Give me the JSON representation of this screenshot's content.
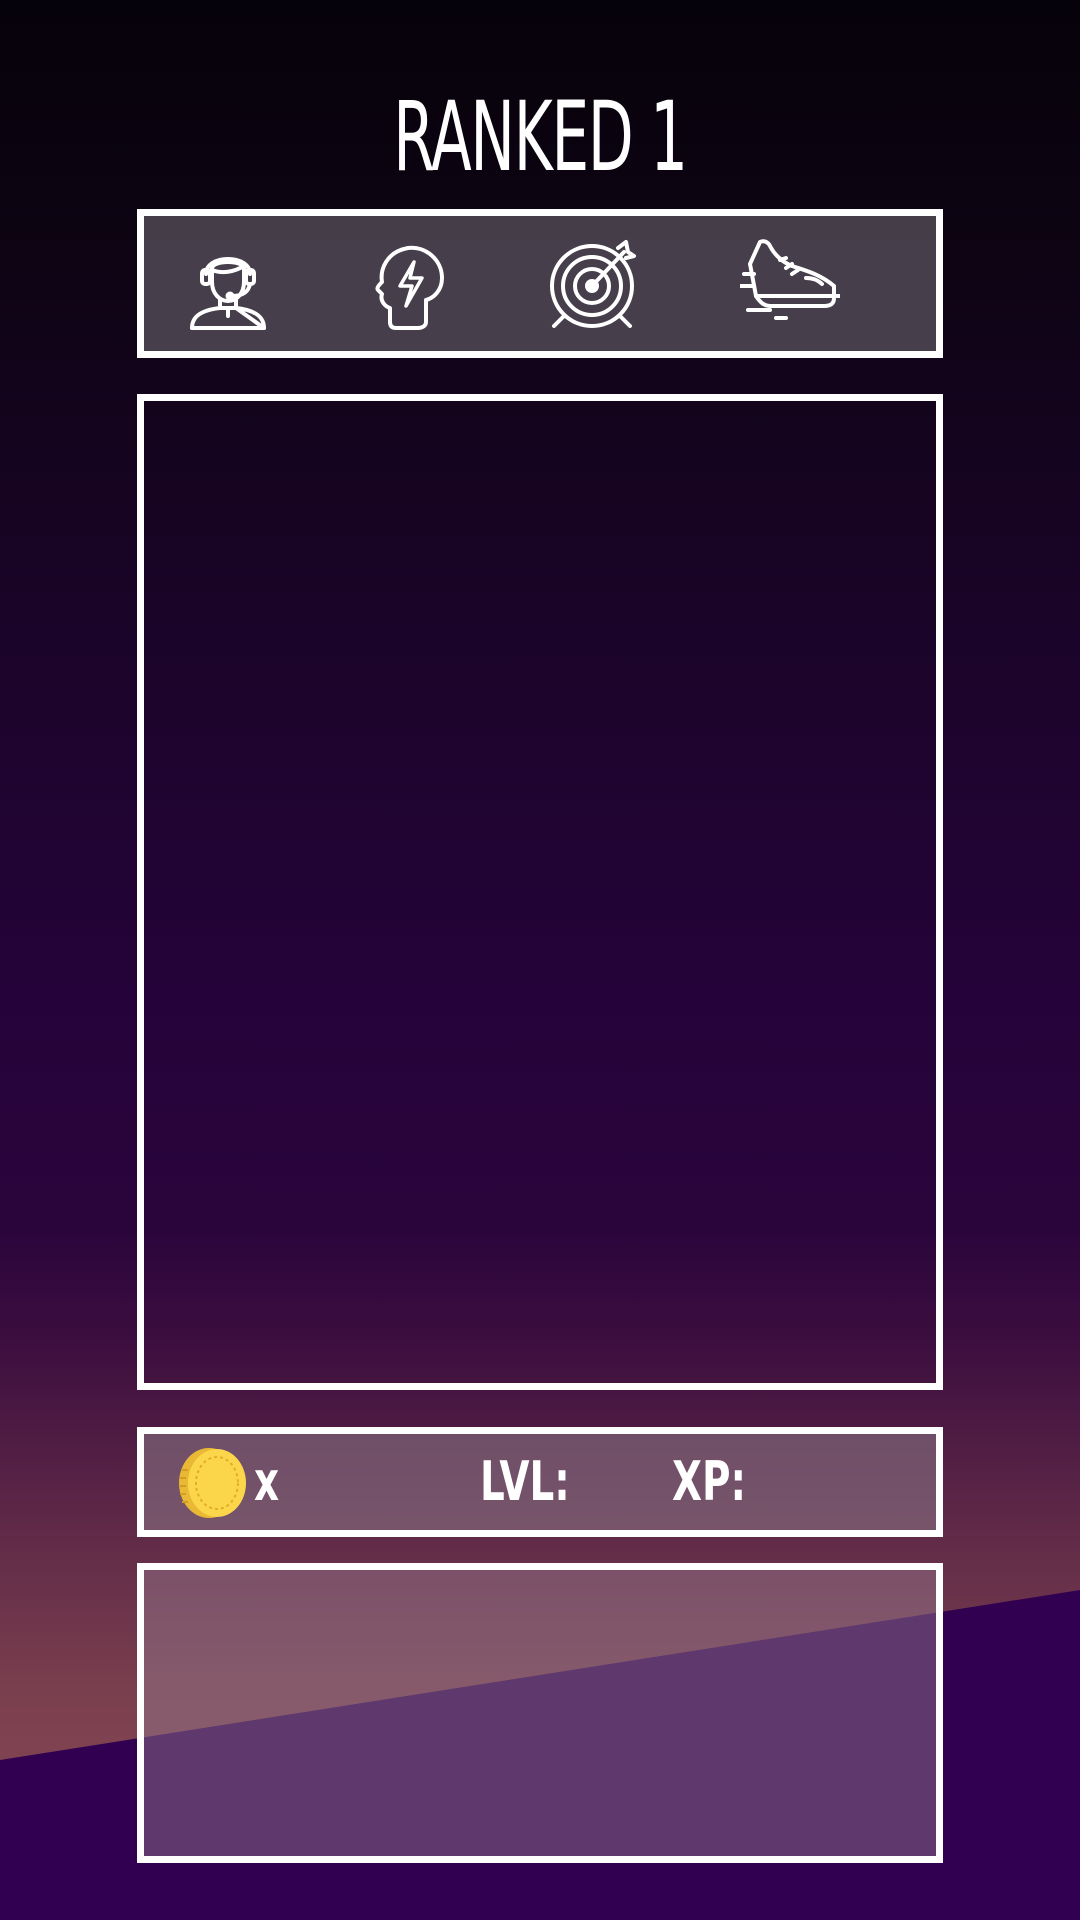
{
  "title": "RANKED 1",
  "stats": {
    "icons": [
      "support-agent-icon",
      "brain-lightning-icon",
      "target-dart-icon",
      "running-shoe-icon"
    ]
  },
  "info": {
    "coins_label": "x",
    "level_label": "LVL:",
    "xp_label": "XP:",
    "coin_icon": "gold-coin-icon"
  },
  "colors": {
    "border": "#ffffff",
    "coin": "#fcd64a",
    "coin_shade": "#e9b935",
    "wedge": "#320050"
  }
}
